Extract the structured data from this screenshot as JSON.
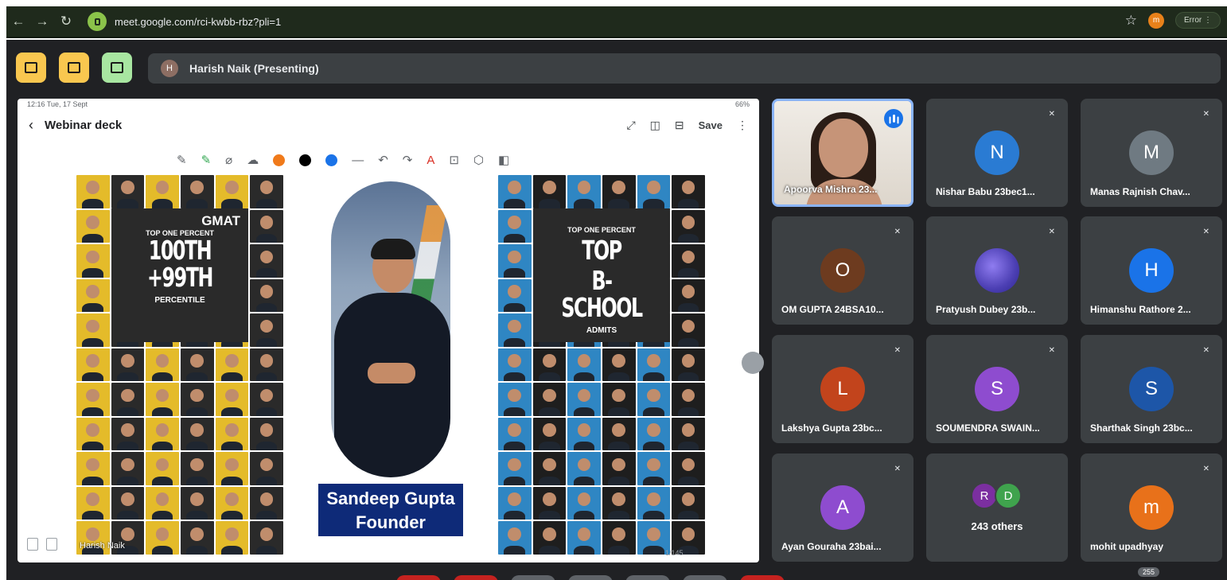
{
  "browser": {
    "url": "meet.google.com/rci-kwbb-rbz?pli=1",
    "profile_initial": "m",
    "error_label": "Error",
    "menu_glyph": "⋮"
  },
  "meet": {
    "presenter_initial": "H",
    "presenter_text": "Harish Naik (Presenting)",
    "participant_count": "255"
  },
  "screen": {
    "status_time": "12:16  Tue, 17 Sept",
    "status_battery": "66%",
    "title": "Webinar deck",
    "save_label": "Save",
    "presenter_label": "Harish Naik",
    "page_indicator": "1/145",
    "pen_colors": [
      "#f07a1a",
      "#000000",
      "#1a73e8"
    ],
    "slide": {
      "left_badge": "GMAT",
      "left_logo": "TOP ONE PERCENT",
      "left_line1": "100TH",
      "left_line2": "+99TH",
      "left_line3": "PERCENTILE",
      "right_logo": "TOP ONE PERCENT",
      "right_line1": "TOP",
      "right_line2": "B-SCHOOL",
      "right_line3": "ADMITS",
      "founder_name": "Sandeep Gupta",
      "founder_title": "Founder"
    }
  },
  "participants": [
    {
      "name": "Apoorva Mishra 23...",
      "initial": "",
      "color": "",
      "speaking": true
    },
    {
      "name": "Nishar Babu 23bec1...",
      "initial": "N",
      "color": "#2a7bd3"
    },
    {
      "name": "Manas Rajnish Chav...",
      "initial": "M",
      "color": "#6f7a82"
    },
    {
      "name": "OM GUPTA 24BSA10...",
      "initial": "O",
      "color": "#6d3b1f"
    },
    {
      "name": "Pratyush Dubey 23b...",
      "initial": "",
      "color": ""
    },
    {
      "name": "Himanshu Rathore 2...",
      "initial": "H",
      "color": "#1a73e8"
    },
    {
      "name": "Lakshya Gupta 23bc...",
      "initial": "L",
      "color": "#c2441c"
    },
    {
      "name": "SOUMENDRA SWAIN...",
      "initial": "S",
      "color": "#8e4ccf"
    },
    {
      "name": "Sharthak Singh 23bc...",
      "initial": "S",
      "color": "#1d56a8"
    },
    {
      "name": "Ayan Gouraha 23bai...",
      "initial": "A",
      "color": "#8e4ccf"
    },
    {
      "name": "mohit upadhyay",
      "initial": "m",
      "color": "#e8711a"
    }
  ],
  "others": {
    "count_text": "243 others",
    "initials": [
      "R",
      "D"
    ],
    "colors": [
      "#7b2fa0",
      "#3fa34d"
    ]
  }
}
